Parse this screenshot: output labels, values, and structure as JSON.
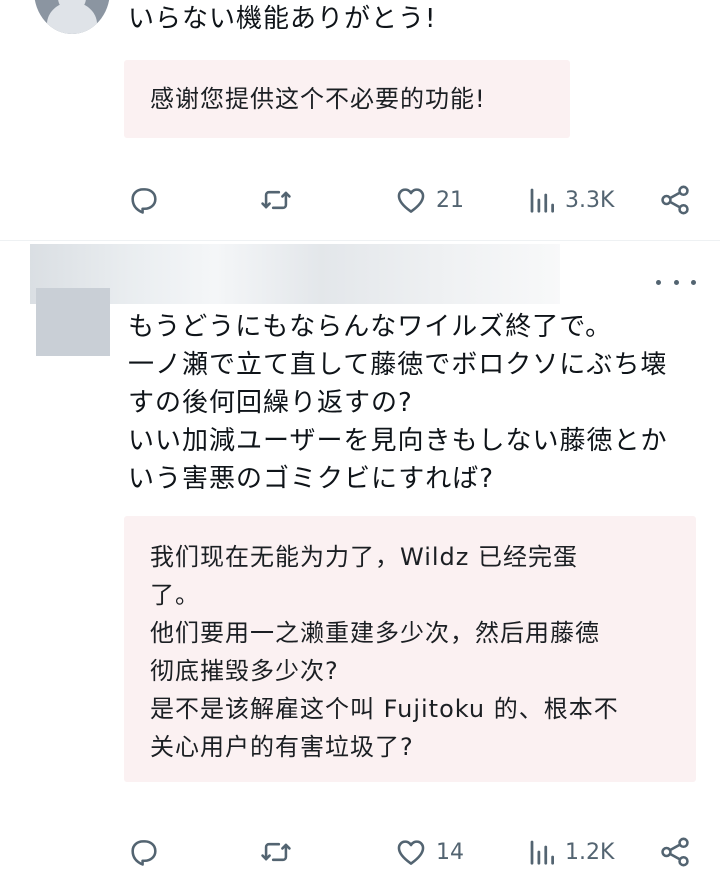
{
  "post1": {
    "text_lines": [
      "いらない機能ありがとう!"
    ],
    "translation_lines": [
      "感谢您提供这个不必要的功能!"
    ],
    "actions": {
      "reply_icon": "speech-bubble-icon",
      "repost_icon": "repost-arrows-icon",
      "like_icon": "heart-icon",
      "like_count": "21",
      "views_icon": "bar-chart-icon",
      "view_count": "3.3K",
      "share_icon": "share-icon"
    }
  },
  "post2": {
    "text_lines": [
      "もうどうにもならんなワイルズ終了で。",
      "一ノ瀬で立て直して藤徳でボロクソにぶち壊",
      "すの後何回繰り返すの?",
      "いい加減ユーザーを見向きもしない藤徳とか",
      "いう害悪のゴミクビにすれば?"
    ],
    "translation_lines": [
      "我们现在无能为力了，Wildz 已经完蛋",
      "了。",
      "他们要用一之濑重建多少次，然后用藤德",
      "彻底摧毁多少次?",
      "是不是该解雇这个叫 Fujitoku 的、根本不",
      "关心用户的有害垃圾了?"
    ],
    "more_icon": "more-options-icon",
    "actions": {
      "reply_icon": "speech-bubble-icon",
      "repost_icon": "repost-arrows-icon",
      "like_icon": "heart-icon",
      "like_count": "14",
      "views_icon": "bar-chart-icon",
      "view_count": "1.2K",
      "share_icon": "share-icon"
    }
  },
  "colors": {
    "text": "#0f1419",
    "muted": "#536471",
    "translation_bg": "#fbf1f2"
  }
}
